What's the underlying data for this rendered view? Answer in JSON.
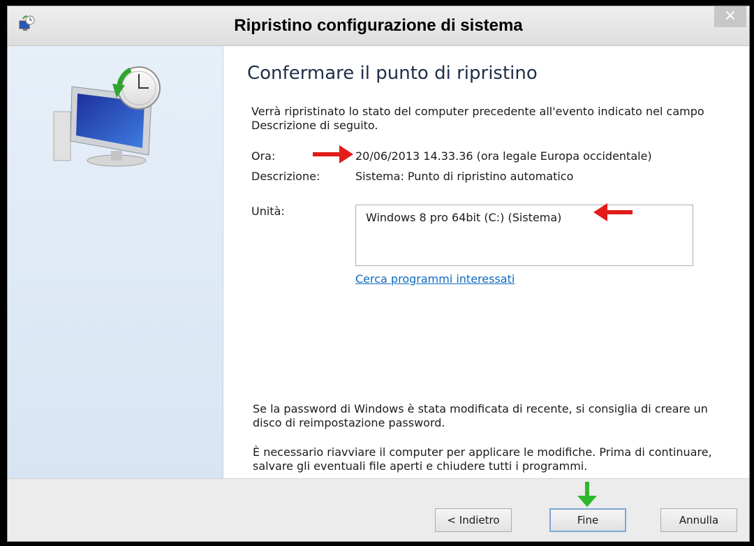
{
  "window": {
    "title": "Ripristino configurazione di sistema",
    "close_glyph": "×"
  },
  "page": {
    "heading": "Confermare il punto di ripristino",
    "intro": "Verrà ripristinato lo stato del computer precedente all'evento indicato nel campo Descrizione di seguito.",
    "time_label": "Ora:",
    "time_value": "20/06/2013 14.33.36 (ora legale Europa occidentale)",
    "description_label": "Descrizione:",
    "description_value": "Sistema: Punto di ripristino automatico",
    "drives_label": "Unità:",
    "drives": [
      "Windows 8 pro 64bit (C:) (Sistema)"
    ],
    "link": "Cerca programmi interessati",
    "password_note": "Se la password di Windows è stata modificata di recente, si consiglia di creare un disco di reimpostazione password.",
    "restart_note": "È necessario riavviare il computer per applicare le modifiche. Prima di continuare, salvare gli eventuali file aperti e chiudere tutti i programmi."
  },
  "buttons": {
    "back": "< Indietro",
    "finish": "Fine",
    "cancel": "Annulla"
  },
  "icons": {
    "app": "system-restore-icon",
    "sidebar": "monitor-clock-icon"
  },
  "colors": {
    "annotation_red": "#e21b1b",
    "annotation_green": "#2db82d",
    "link": "#0d6ac0"
  }
}
